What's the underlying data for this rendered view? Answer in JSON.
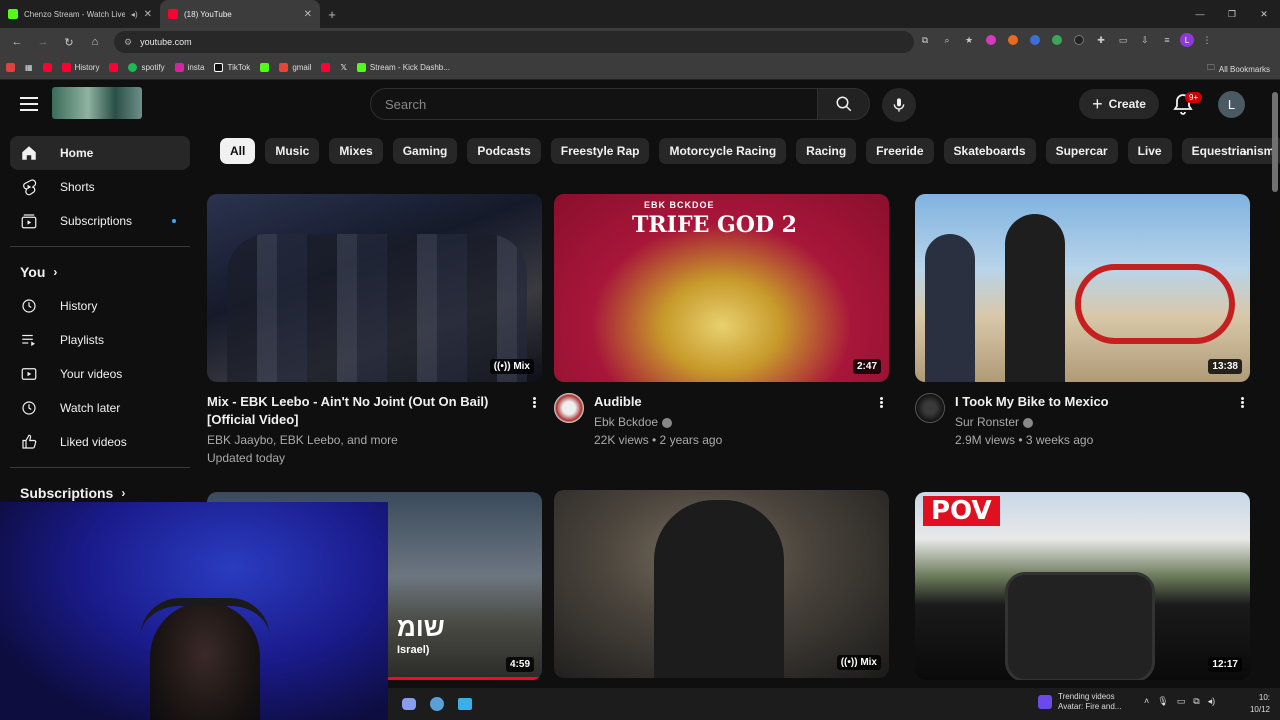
{
  "browser": {
    "tabs": [
      {
        "title": "Chenzo Stream - Watch Live",
        "favicon_color": "#53fc18",
        "active": false
      },
      {
        "title": "(18) YouTube",
        "favicon_color": "#ff0033",
        "active": true
      }
    ],
    "new_tab": "+",
    "url": "youtube.com",
    "bookmarks": [
      {
        "label": "",
        "color": "#ff0033"
      },
      {
        "label": "History",
        "color": "#ff0033"
      },
      {
        "label": "",
        "color": "#ff0033"
      },
      {
        "label": "spotify",
        "color": "#1db954"
      },
      {
        "label": "insta",
        "color": "#d6249f"
      },
      {
        "label": "TikTok",
        "color": "#ffffff"
      },
      {
        "label": "",
        "color": "#53fc18"
      },
      {
        "label": "gmail",
        "color": "#ea4335"
      },
      {
        "label": "",
        "color": "#ff0033"
      },
      {
        "label": "",
        "color": "#ffffff"
      },
      {
        "label": "Stream - Kick Dashb...",
        "color": "#53fc18"
      }
    ],
    "all_bookmarks": "All Bookmarks",
    "profile_initial": "L"
  },
  "masthead": {
    "search_placeholder": "Search",
    "create_label": "Create",
    "notification_badge": "9+",
    "avatar_initial": "L"
  },
  "sidebar": {
    "primary": [
      {
        "label": "Home",
        "icon": "home-icon",
        "active": true
      },
      {
        "label": "Shorts",
        "icon": "shorts-icon"
      },
      {
        "label": "Subscriptions",
        "icon": "subscriptions-icon",
        "dot": true
      }
    ],
    "you_heading": "You",
    "you_items": [
      {
        "label": "History",
        "icon": "history-icon"
      },
      {
        "label": "Playlists",
        "icon": "playlists-icon"
      },
      {
        "label": "Your videos",
        "icon": "your-videos-icon"
      },
      {
        "label": "Watch later",
        "icon": "watch-later-icon"
      },
      {
        "label": "Liked videos",
        "icon": "liked-videos-icon"
      }
    ],
    "subscriptions_heading": "Subscriptions"
  },
  "chips": [
    "All",
    "Music",
    "Mixes",
    "Gaming",
    "Podcasts",
    "Freestyle Rap",
    "Motorcycle Racing",
    "Racing",
    "Freeride",
    "Skateboards",
    "Supercar",
    "Live",
    "Equestrianism"
  ],
  "videos": [
    {
      "title": "Mix - EBK Leebo - Ain't No Joint (Out On Bail) [Official Video]",
      "line1": "EBK Jaaybo, EBK Leebo, and more",
      "line2": "Updated today",
      "badge": "Mix",
      "thumb_colors": [
        "#1c2236",
        "#3a4a6a"
      ],
      "has_avatar": false
    },
    {
      "title": "Audible",
      "line1": "Ebk Bckdoe",
      "line2": "22K views • 2 years ago",
      "badge": "2:47",
      "thumb_colors": [
        "#b3123a",
        "#e8c34a"
      ],
      "avatar_color": "#c7c7c7",
      "verified": true,
      "has_avatar": true,
      "art_text_1": "EBK BCKDOE",
      "art_text_2": "TRIFE GOD 2"
    },
    {
      "title": "I Took My Bike to Mexico",
      "line1": "Sur Ronster",
      "line2": "2.9M views • 3 weeks ago",
      "badge": "13:38",
      "thumb_colors": [
        "#8fb6d6",
        "#c7b89a"
      ],
      "avatar_color": "#1a1a1a",
      "verified": true,
      "has_avatar": true
    },
    {
      "title": "",
      "line1": "",
      "line2": "",
      "badge": "4:59",
      "thumb_colors": [
        "#2c3a4a",
        "#6a6a6a"
      ],
      "has_avatar": false,
      "art_text": "שומ",
      "art_sub": "Israel)"
    },
    {
      "title": "",
      "line1": "",
      "line2": "",
      "badge": "Mix",
      "thumb_colors": [
        "#4a4a44",
        "#1a1a1a"
      ],
      "has_avatar": false
    },
    {
      "title": "",
      "line1": "",
      "line2": "",
      "badge": "12:17",
      "thumb_colors": [
        "#2a2a2a",
        "#9ab0c8"
      ],
      "has_avatar": false,
      "pov_label": "POV"
    }
  ],
  "taskbar": {
    "trend_title": "Trending videos",
    "trend_sub": "Avatar: Fire and...",
    "clock_time": "10:",
    "clock_date": "10/12"
  }
}
